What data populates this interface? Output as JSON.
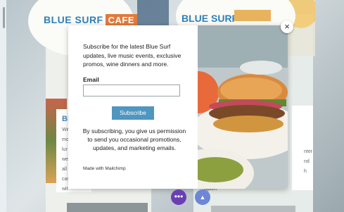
{
  "background": {
    "logo_left": "BLUE SURF",
    "logo_left_badge": "CAFE",
    "logo_right": "BLUE SURF",
    "card_left_heading": "Bl",
    "card_left_lines": [
      "We",
      "mo",
      "lur",
      "we",
      "all",
      "cas",
      "wit"
    ],
    "card_right_lines": [
      "nter",
      "nd",
      "h"
    ],
    "apart_text": "apart"
  },
  "modal": {
    "intro": "Subscribe for the latest Blue Surf updates, live music events, exclusive promos, wine dinners and more.",
    "email_label": "Email",
    "email_value": "",
    "subscribe_label": "Subscribe",
    "disclaimer": "By subscribing, you give us permission to send you occasional promotions, updates, and marketing emails.",
    "made_with": "Made with Mailchimp",
    "close_symbol": "×"
  },
  "fabs": {
    "chat_symbol": "•••",
    "badge_symbol": "▲"
  },
  "colors": {
    "accent_blue": "#4f96c0",
    "logo_blue": "#2d80b8",
    "cafe_orange": "#e07a3c",
    "fab_purple": "#6a3fb5"
  }
}
